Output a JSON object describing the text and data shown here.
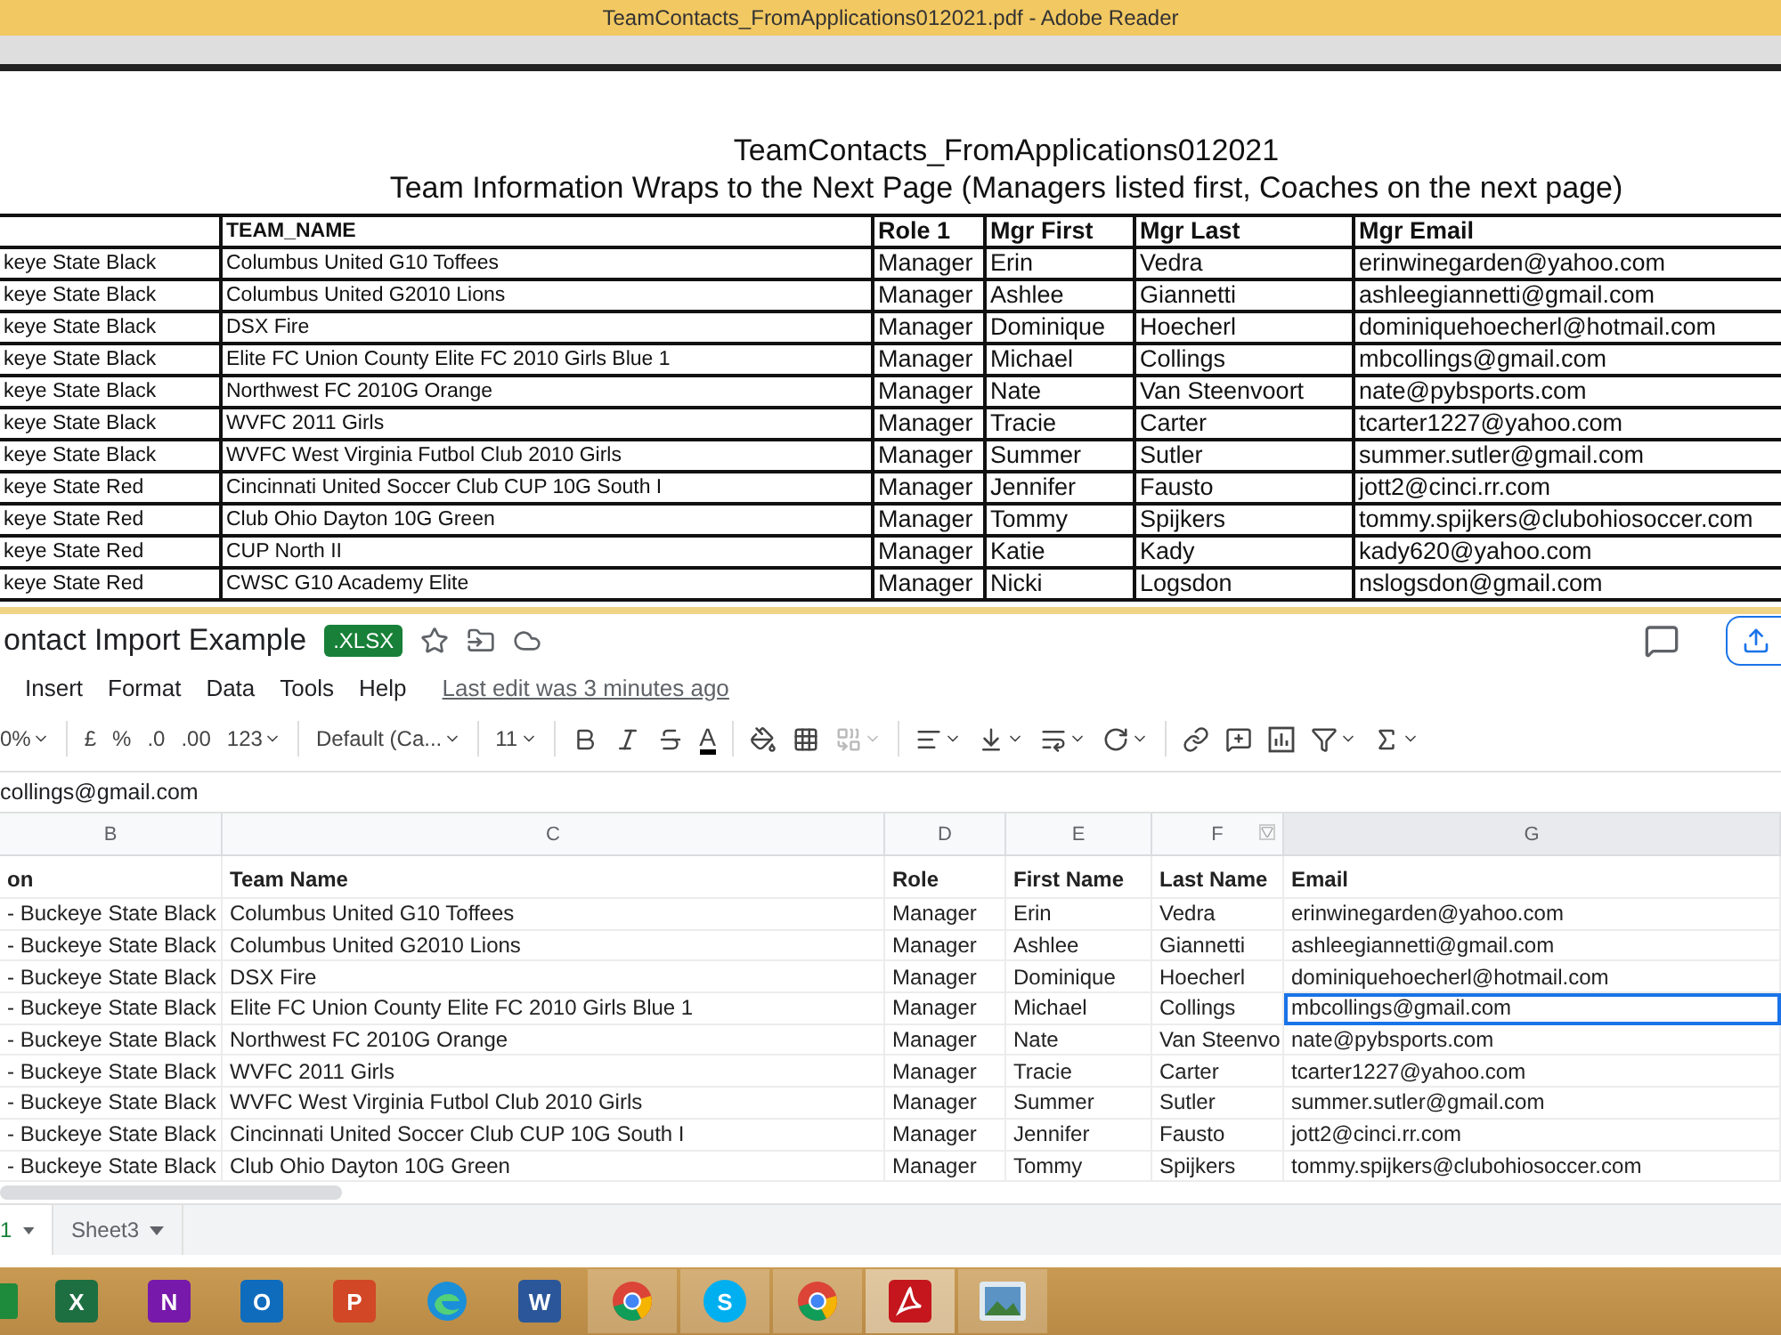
{
  "window": {
    "title": "TeamContacts_FromApplications012021.pdf - Adobe Reader"
  },
  "pdf": {
    "title": "TeamContacts_FromApplications012021",
    "subtitle": "Team Information Wraps to the Next Page (Managers listed first, Coaches on the next page)",
    "columns": [
      "",
      "TEAM_NAME",
      "Role 1",
      "Mgr First",
      "Mgr Last",
      "Mgr Email"
    ],
    "rows": [
      [
        "keye State Black",
        "Columbus United G10 Toffees",
        "Manager",
        "Erin",
        "Vedra",
        "erinwinegarden@yahoo.com"
      ],
      [
        "keye State Black",
        "Columbus United G2010 Lions",
        "Manager",
        "Ashlee",
        "Giannetti",
        "ashleegiannetti@gmail.com"
      ],
      [
        "keye State Black",
        "DSX Fire",
        "Manager",
        "Dominique",
        "Hoecherl",
        "dominiquehoecherl@hotmail.com"
      ],
      [
        "keye State Black",
        "Elite FC Union County Elite FC 2010 Girls Blue 1",
        "Manager",
        "Michael",
        "Collings",
        "mbcollings@gmail.com"
      ],
      [
        "keye State Black",
        "Northwest FC 2010G Orange",
        "Manager",
        "Nate",
        "Van Steenvoort",
        "nate@pybsports.com"
      ],
      [
        "keye State Black",
        "WVFC 2011 Girls",
        "Manager",
        "Tracie",
        "Carter",
        "tcarter1227@yahoo.com"
      ],
      [
        "keye State Black",
        "WVFC West Virginia Futbol Club 2010 Girls",
        "Manager",
        "Summer",
        "Sutler",
        "summer.sutler@gmail.com"
      ],
      [
        "keye State Red",
        "Cincinnati United Soccer Club CUP 10G South I",
        "Manager",
        "Jennifer",
        "Fausto",
        "jott2@cinci.rr.com"
      ],
      [
        "keye State Red",
        "Club Ohio Dayton 10G Green",
        "Manager",
        "Tommy",
        "Spijkers",
        "tommy.spijkers@clubohiosoccer.com"
      ],
      [
        "keye State Red",
        "CUP North II",
        "Manager",
        "Katie",
        "Kady",
        "kady620@yahoo.com"
      ],
      [
        "keye State Red",
        "CWSC G10 Academy Elite",
        "Manager",
        "Nicki",
        "Logsdon",
        "nslogsdon@gmail.com"
      ]
    ]
  },
  "sheet": {
    "doc_title": "ontact Import Example",
    "badge": ".XLSX",
    "menu": [
      "Insert",
      "Format",
      "Data",
      "Tools",
      "Help"
    ],
    "last_edit": "Last edit was 3 minutes ago",
    "toolbar": [
      {
        "kind": "text",
        "label": "0%",
        "menu": true,
        "disabled": false
      },
      {
        "kind": "divider"
      },
      {
        "kind": "text",
        "label": "£",
        "menu": false,
        "disabled": false
      },
      {
        "kind": "text",
        "label": "%",
        "menu": false,
        "disabled": false
      },
      {
        "kind": "text",
        "label": ".0",
        "menu": false,
        "disabled": false
      },
      {
        "kind": "text",
        "label": ".00",
        "menu": false,
        "disabled": false
      },
      {
        "kind": "text",
        "label": "123",
        "menu": true,
        "disabled": false
      },
      {
        "kind": "divider"
      },
      {
        "kind": "text",
        "label": "Default (Ca...",
        "menu": true,
        "disabled": false
      },
      {
        "kind": "divider"
      },
      {
        "kind": "text",
        "label": "11",
        "menu": true,
        "disabled": false
      },
      {
        "kind": "divider"
      },
      {
        "kind": "bold",
        "menu": false,
        "disabled": false
      },
      {
        "kind": "italic",
        "menu": false,
        "disabled": false
      },
      {
        "kind": "strike",
        "menu": false,
        "disabled": false
      },
      {
        "kind": "textcolor",
        "label": "A",
        "menu": false,
        "disabled": false
      },
      {
        "kind": "divider"
      },
      {
        "kind": "fill",
        "menu": false,
        "disabled": false
      },
      {
        "kind": "borders",
        "menu": false,
        "disabled": false
      },
      {
        "kind": "merge",
        "menu": true,
        "disabled": true
      },
      {
        "kind": "divider"
      },
      {
        "kind": "align",
        "menu": true,
        "disabled": false
      },
      {
        "kind": "valign",
        "menu": true,
        "disabled": false
      },
      {
        "kind": "wrap",
        "menu": true,
        "disabled": false
      },
      {
        "kind": "rotate",
        "menu": true,
        "disabled": false
      },
      {
        "kind": "divider"
      },
      {
        "kind": "link",
        "menu": false,
        "disabled": false
      },
      {
        "kind": "comment",
        "menu": false,
        "disabled": false
      },
      {
        "kind": "chart",
        "menu": false,
        "disabled": false
      },
      {
        "kind": "filter",
        "menu": true,
        "disabled": false
      },
      {
        "kind": "sigma",
        "menu": true,
        "disabled": false
      }
    ],
    "formula": "collings@gmail.com",
    "column_letters": [
      "B",
      "C",
      "D",
      "E",
      "F",
      "G"
    ],
    "header": [
      "on",
      "Team Name",
      "Role",
      "First Name",
      "Last Name",
      "Email"
    ],
    "rows": [
      {
        "cells": [
          "- Buckeye State Black",
          "Columbus United G10 Toffees",
          "Manager",
          "Erin",
          "Vedra",
          "erinwinegarden@yahoo.com"
        ],
        "selected": false
      },
      {
        "cells": [
          "- Buckeye State Black",
          "Columbus United G2010 Lions",
          "Manager",
          "Ashlee",
          "Giannetti",
          "ashleegiannetti@gmail.com"
        ],
        "selected": false
      },
      {
        "cells": [
          "- Buckeye State Black",
          "DSX Fire",
          "Manager",
          "Dominique",
          "Hoecherl",
          "dominiquehoecherl@hotmail.com"
        ],
        "selected": false
      },
      {
        "cells": [
          "- Buckeye State Black",
          "Elite FC Union County Elite FC 2010 Girls Blue 1",
          "Manager",
          "Michael",
          "Collings",
          "mbcollings@gmail.com"
        ],
        "selected": true
      },
      {
        "cells": [
          "- Buckeye State Black",
          "Northwest FC 2010G Orange",
          "Manager",
          "Nate",
          "Van Steenvo",
          "nate@pybsports.com"
        ],
        "selected": false
      },
      {
        "cells": [
          "- Buckeye State Black",
          "WVFC 2011 Girls",
          "Manager",
          "Tracie",
          "Carter",
          "tcarter1227@yahoo.com"
        ],
        "selected": false
      },
      {
        "cells": [
          "- Buckeye State Black",
          "WVFC West Virginia Futbol Club 2010 Girls",
          "Manager",
          "Summer",
          "Sutler",
          "summer.sutler@gmail.com"
        ],
        "selected": false
      },
      {
        "cells": [
          "- Buckeye State Black",
          "Cincinnati United Soccer Club CUP 10G South I",
          "Manager",
          "Jennifer",
          "Fausto",
          "jott2@cinci.rr.com"
        ],
        "selected": false
      },
      {
        "cells": [
          "- Buckeye State Black",
          "Club Ohio Dayton 10G Green",
          "Manager",
          "Tommy",
          "Spijkers",
          "tommy.spijkers@clubohiosoccer.com"
        ],
        "selected": false
      }
    ],
    "tabs": [
      {
        "label": "1",
        "selected": true
      },
      {
        "label": "Sheet3",
        "selected": false
      }
    ]
  },
  "taskbar": [
    {
      "kind": "store",
      "open": false,
      "selected": false
    },
    {
      "kind": "excel",
      "label": "X",
      "open": false,
      "selected": false
    },
    {
      "kind": "onenote",
      "label": "N",
      "open": false,
      "selected": false
    },
    {
      "kind": "outlook",
      "label": "O",
      "open": false,
      "selected": false
    },
    {
      "kind": "powerpoint",
      "label": "P",
      "open": false,
      "selected": false
    },
    {
      "kind": "edge",
      "open": false,
      "selected": false
    },
    {
      "kind": "word",
      "label": "W",
      "open": false,
      "selected": false
    },
    {
      "kind": "chrome",
      "open": true,
      "selected": false
    },
    {
      "kind": "skype",
      "label": "S",
      "open": true,
      "selected": false
    },
    {
      "kind": "chrome",
      "open": true,
      "selected": false
    },
    {
      "kind": "acrobat",
      "open": true,
      "selected": true
    },
    {
      "kind": "photos",
      "open": true,
      "selected": false
    }
  ]
}
